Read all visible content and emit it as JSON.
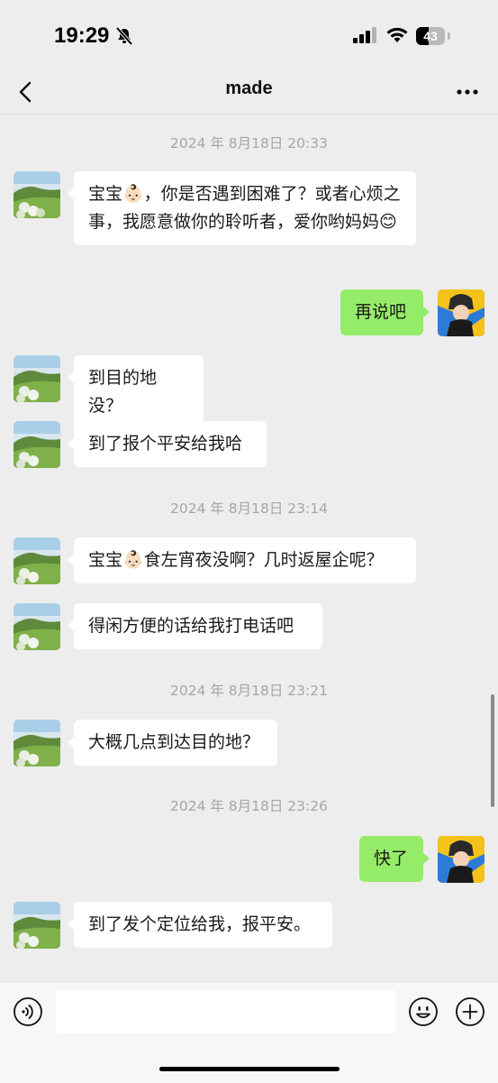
{
  "status_bar": {
    "time": "19:29",
    "battery": "43",
    "battery_level": 0.43
  },
  "header": {
    "title": "made"
  },
  "messages": [
    {
      "type": "timestamp",
      "text": "2024 年 8月18日 20:33"
    },
    {
      "type": "incoming",
      "text": "宝宝👶🏻，你是否遇到困难了？或者心烦之事，我愿意做你的聆听者，爱你哟妈妈😊"
    },
    {
      "type": "outgoing",
      "text": "再说吧"
    },
    {
      "type": "incoming",
      "text": "到目的地没？"
    },
    {
      "type": "incoming",
      "text": "到了报个平安给我哈"
    },
    {
      "type": "timestamp",
      "text": "2024 年 8月18日 23:14"
    },
    {
      "type": "incoming",
      "text": "宝宝👶🏻食左宵夜没啊？几时返屋企呢？"
    },
    {
      "type": "incoming",
      "text": "得闲方便的话给我打电话吧"
    },
    {
      "type": "timestamp",
      "text": "2024 年 8月18日 23:21"
    },
    {
      "type": "incoming",
      "text": "大概几点到达目的地？"
    },
    {
      "type": "timestamp",
      "text": "2024 年 8月18日 23:26"
    },
    {
      "type": "outgoing",
      "text": "快了"
    },
    {
      "type": "incoming",
      "text": "到了发个定位给我，报平安。"
    }
  ],
  "input": {
    "placeholder": ""
  },
  "colors": {
    "background": "#ededed",
    "outgoing_bubble": "#95ec69",
    "incoming_bubble": "#ffffff",
    "timestamp": "#a6a6a6"
  },
  "icons": [
    "bell-slash-icon",
    "signal-icon",
    "wifi-icon",
    "battery-icon",
    "back-chevron-icon",
    "more-dots-icon",
    "voice-icon",
    "emoji-icon",
    "plus-icon"
  ]
}
